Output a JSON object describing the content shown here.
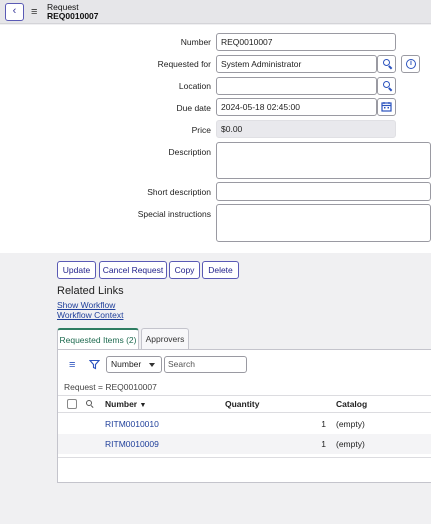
{
  "header": {
    "title": "Request",
    "number": "REQ0010007"
  },
  "form": {
    "number_label": "Number",
    "number_value": "REQ0010007",
    "requested_for_label": "Requested for",
    "requested_for_value": "System Administrator",
    "location_label": "Location",
    "location_value": "",
    "due_date_label": "Due date",
    "due_date_value": "2024-05-18 02:45:00",
    "price_label": "Price",
    "price_value": "$0.00",
    "description_label": "Description",
    "short_description_label": "Short description",
    "special_instructions_label": "Special instructions"
  },
  "actions": {
    "update": "Update",
    "cancel_request": "Cancel Request",
    "copy": "Copy",
    "delete": "Delete"
  },
  "related_links": {
    "title": "Related Links",
    "show_workflow": "Show Workflow",
    "workflow_context": "Workflow Context"
  },
  "tabs": [
    {
      "label": "Requested Items (2)"
    },
    {
      "label": "Approvers"
    }
  ],
  "list": {
    "search_field": "Number",
    "search_placeholder": "Search",
    "filter_crumb": "Request = REQ0010007",
    "columns": {
      "number": "Number",
      "quantity": "Quantity",
      "catalog": "Catalog"
    },
    "sort_indicator": "▼",
    "rows": [
      {
        "number": "RITM0010010",
        "quantity": "1",
        "catalog": "(empty)"
      },
      {
        "number": "RITM0010009",
        "quantity": "1",
        "catalog": "(empty)"
      }
    ]
  },
  "icons": {
    "back": "chevron-left-icon",
    "menu": "hamburger-menu-icon",
    "search": "search-icon",
    "info": "info-icon",
    "calendar": "calendar-icon",
    "filter": "filter-icon",
    "list_menu": "list-menu-icon",
    "checkbox": "checkbox-icon"
  },
  "colors": {
    "link": "#1f3f9a",
    "accent": "#2f7d62",
    "button_border": "#5a5ab5",
    "icon_blue": "#2a52be"
  }
}
